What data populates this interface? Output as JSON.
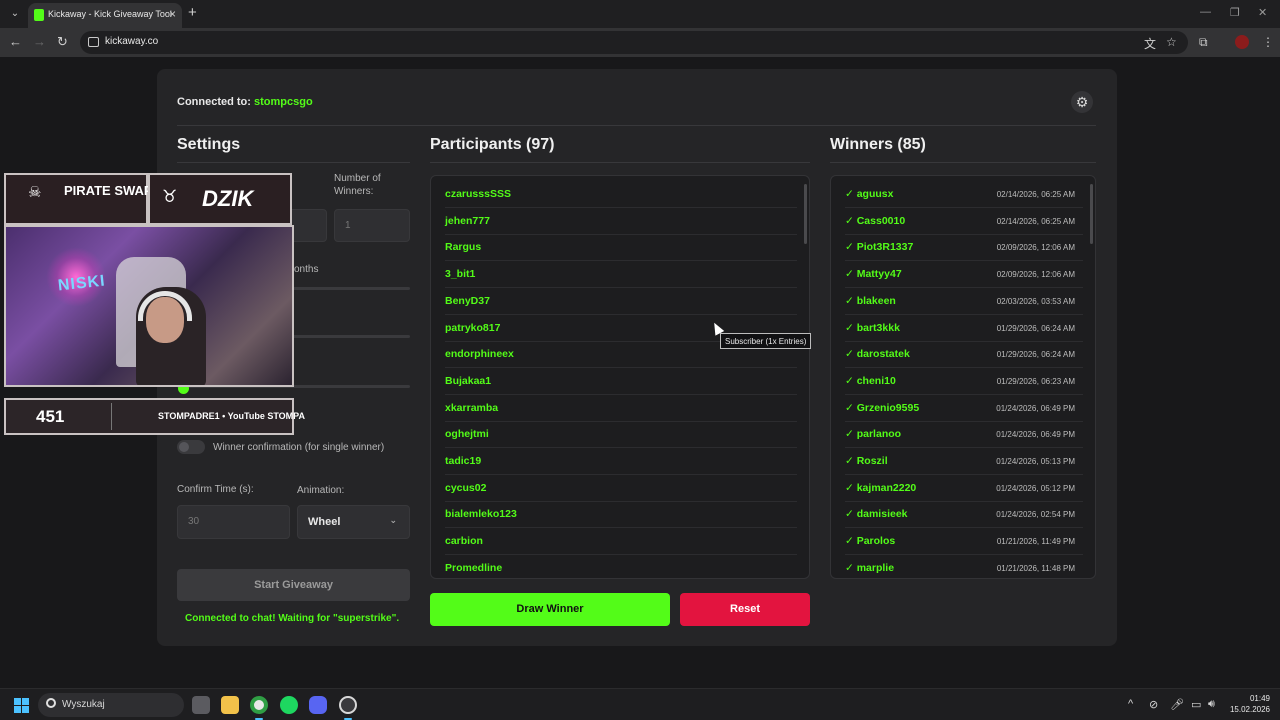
{
  "browser": {
    "tab_title": "Kickaway - Kick Giveaway Tool",
    "url": "kickaway.co"
  },
  "app": {
    "connected_label": "Connected to:",
    "channel": "stompcsgo",
    "settings_title": "Settings",
    "number_of_winners_label": "Number of Winners:",
    "number_of_winners_value": "1",
    "months_label": "onths",
    "winner_confirmation_label": "Winner confirmation (for single winner)",
    "confirm_time_label": "Confirm Time (s):",
    "confirm_time_value": "30",
    "animation_label": "Animation:",
    "animation_value": "Wheel",
    "start_button": "Start Giveaway",
    "status_message": "Connected to chat! Waiting for \"superstrike\".",
    "participants_title": "Participants (97)",
    "winners_title": "Winners (85)",
    "draw_button": "Draw Winner",
    "reset_button": "Reset",
    "tooltip": "Subscriber (1x Entries)",
    "brand_color": "#53fc18",
    "reset_color": "#e3143f"
  },
  "participants": [
    "czarusssSSS",
    "jehen777",
    "Rargus",
    "3_bit1",
    "BenyD37",
    "patryko817",
    "endorphineex",
    "Bujakaa1",
    "xkarramba",
    "oghejtmi",
    "tadic19",
    "cycus02",
    "bialemleko123",
    "carbion",
    "Promedline"
  ],
  "winners": [
    {
      "name": "aguusx",
      "date": "02/14/2026, 06:25 AM"
    },
    {
      "name": "Cass0010",
      "date": "02/14/2026, 06:25 AM"
    },
    {
      "name": "Piot3R1337",
      "date": "02/09/2026, 12:06 AM"
    },
    {
      "name": "Mattyy47",
      "date": "02/09/2026, 12:06 AM"
    },
    {
      "name": "blakeen",
      "date": "02/03/2026, 03:53 AM"
    },
    {
      "name": "bart3kkk",
      "date": "01/29/2026, 06:24 AM"
    },
    {
      "name": "darostatek",
      "date": "01/29/2026, 06:24 AM"
    },
    {
      "name": "cheni10",
      "date": "01/29/2026, 06:23 AM"
    },
    {
      "name": "Grzenio9595",
      "date": "01/24/2026, 06:49 PM"
    },
    {
      "name": "parlanoo",
      "date": "01/24/2026, 06:49 PM"
    },
    {
      "name": "Roszil",
      "date": "01/24/2026, 05:13 PM"
    },
    {
      "name": "kajman2220",
      "date": "01/24/2026, 05:12 PM"
    },
    {
      "name": "damisieek",
      "date": "01/24/2026, 02:54 PM"
    },
    {
      "name": "Parolos",
      "date": "01/21/2026, 11:49 PM"
    },
    {
      "name": "marplie",
      "date": "01/21/2026, 11:48 PM"
    }
  ],
  "overlay": {
    "sponsor_1": "PIRATE SWAP",
    "sponsor_2": "DZIK",
    "viewer_count": "451",
    "socials": "STOMPADRE1 • YouTube STOMPA",
    "neon_sign": "NISKI"
  },
  "taskbar": {
    "search_placeholder": "Wyszukaj",
    "time": "01:49",
    "date": "15.02.2026"
  }
}
